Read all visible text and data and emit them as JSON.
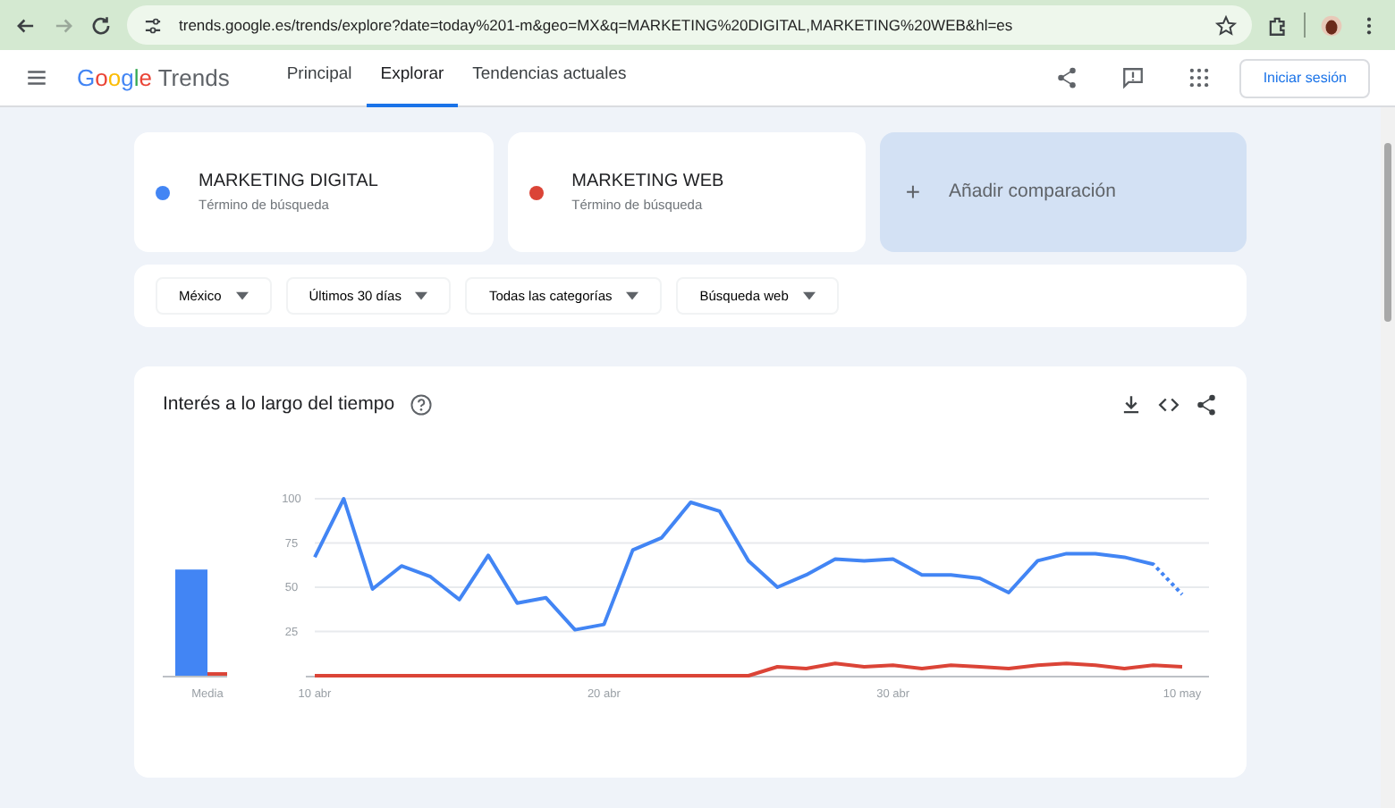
{
  "browser": {
    "url": "trends.google.es/trends/explore?date=today%201-m&geo=MX&q=MARKETING%20DIGITAL,MARKETING%20WEB&hl=es",
    "forward_disabled": true
  },
  "header": {
    "logo_google": "Google",
    "logo_product": "Trends",
    "nav": [
      {
        "label": "Principal",
        "selected": false
      },
      {
        "label": "Explorar",
        "selected": true
      },
      {
        "label": "Tendencias actuales",
        "selected": false
      }
    ],
    "sign_in": "Iniciar sesión"
  },
  "terms": [
    {
      "name": "MARKETING DIGITAL",
      "subtitle": "Término de búsqueda",
      "color": "#4285f4"
    },
    {
      "name": "MARKETING WEB",
      "subtitle": "Término de búsqueda",
      "color": "#db4437"
    }
  ],
  "add_comparison": {
    "symbol": "+",
    "label": "Añadir comparación"
  },
  "filters": [
    "México",
    "Últimos 30 días",
    "Todas las categorías",
    "Búsqueda web"
  ],
  "interest_card": {
    "title": "Interés a lo largo del tiempo",
    "averages": {
      "chart_data": {
        "type": "bar",
        "categories": [
          "Media"
        ],
        "ylim": [
          0,
          100
        ],
        "series": [
          {
            "color": "#4285f4",
            "values": [
              60
            ]
          },
          {
            "color": "#db4437",
            "values": [
              2
            ]
          }
        ]
      }
    },
    "timeline": {
      "chart_data": {
        "type": "line",
        "categories": [
          "10 abr",
          null,
          null,
          null,
          null,
          null,
          null,
          null,
          null,
          null,
          "20 abr",
          null,
          null,
          null,
          null,
          null,
          null,
          null,
          null,
          null,
          "30 abr",
          null,
          null,
          null,
          null,
          null,
          null,
          null,
          null,
          null,
          "10 may"
        ],
        "ylim": [
          0,
          100
        ],
        "yticks": [
          25,
          50,
          75,
          100
        ],
        "grid": true,
        "series": [
          {
            "color": "#4285f4",
            "values": [
              67,
              100,
              49,
              62,
              56,
              43,
              68,
              41,
              44,
              26,
              29,
              71,
              78,
              98,
              93,
              65,
              50,
              57,
              66,
              65,
              66,
              57,
              57,
              55,
              47,
              65,
              69,
              69,
              67,
              63,
              46
            ]
          },
          {
            "color": "#db4437",
            "values": [
              0,
              0,
              0,
              0,
              0,
              0,
              0,
              0,
              0,
              0,
              0,
              0,
              0,
              0,
              0,
              0,
              5,
              4,
              7,
              5,
              6,
              4,
              6,
              5,
              4,
              6,
              7,
              6,
              4,
              6,
              5
            ]
          }
        ]
      }
    }
  }
}
